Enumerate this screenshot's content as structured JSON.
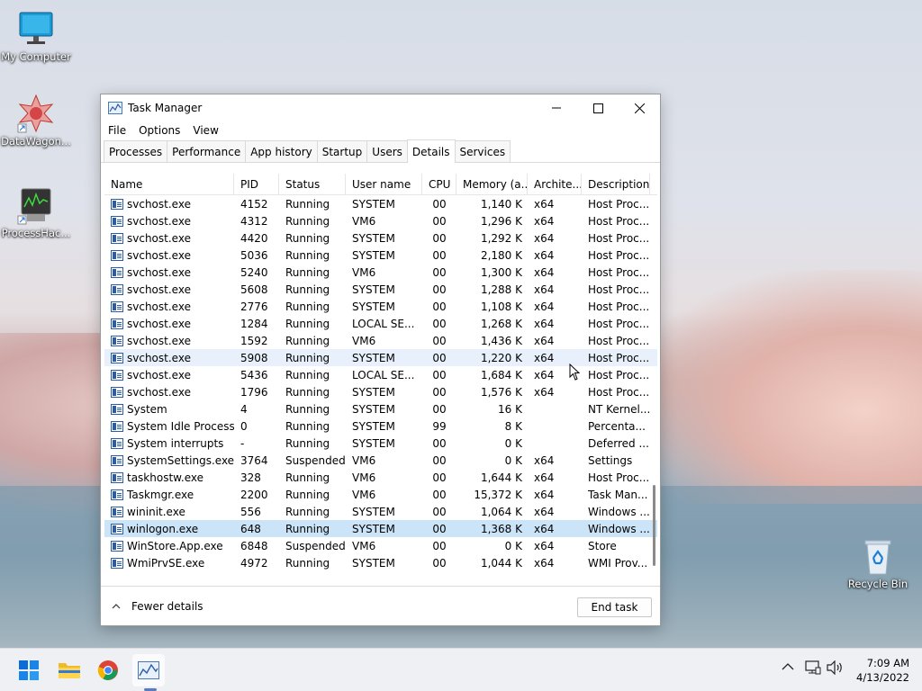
{
  "desktop": {
    "icons": [
      {
        "label": "My Computer"
      },
      {
        "label": "DataWagon..."
      },
      {
        "label": "ProcessHac..."
      },
      {
        "label": "Recycle Bin"
      }
    ]
  },
  "window": {
    "title": "Task Manager",
    "menu": [
      "File",
      "Options",
      "View"
    ],
    "tabs": [
      "Processes",
      "Performance",
      "App history",
      "Startup",
      "Users",
      "Details",
      "Services"
    ],
    "active_tab": "Details",
    "columns": [
      "Name",
      "PID",
      "Status",
      "User name",
      "CPU",
      "Memory (a...",
      "Archite...",
      "Description"
    ],
    "rows": [
      {
        "name": "svchost.exe",
        "pid": "4152",
        "status": "Running",
        "user": "SYSTEM",
        "cpu": "00",
        "mem": "1,140 K",
        "arch": "x64",
        "desc": "Host Proc..."
      },
      {
        "name": "svchost.exe",
        "pid": "4312",
        "status": "Running",
        "user": "VM6",
        "cpu": "00",
        "mem": "1,296 K",
        "arch": "x64",
        "desc": "Host Proc..."
      },
      {
        "name": "svchost.exe",
        "pid": "4420",
        "status": "Running",
        "user": "SYSTEM",
        "cpu": "00",
        "mem": "1,292 K",
        "arch": "x64",
        "desc": "Host Proc..."
      },
      {
        "name": "svchost.exe",
        "pid": "5036",
        "status": "Running",
        "user": "SYSTEM",
        "cpu": "00",
        "mem": "2,180 K",
        "arch": "x64",
        "desc": "Host Proc..."
      },
      {
        "name": "svchost.exe",
        "pid": "5240",
        "status": "Running",
        "user": "VM6",
        "cpu": "00",
        "mem": "1,300 K",
        "arch": "x64",
        "desc": "Host Proc..."
      },
      {
        "name": "svchost.exe",
        "pid": "5608",
        "status": "Running",
        "user": "SYSTEM",
        "cpu": "00",
        "mem": "1,288 K",
        "arch": "x64",
        "desc": "Host Proc..."
      },
      {
        "name": "svchost.exe",
        "pid": "2776",
        "status": "Running",
        "user": "SYSTEM",
        "cpu": "00",
        "mem": "1,108 K",
        "arch": "x64",
        "desc": "Host Proc..."
      },
      {
        "name": "svchost.exe",
        "pid": "1284",
        "status": "Running",
        "user": "LOCAL SE...",
        "cpu": "00",
        "mem": "1,268 K",
        "arch": "x64",
        "desc": "Host Proc..."
      },
      {
        "name": "svchost.exe",
        "pid": "1592",
        "status": "Running",
        "user": "VM6",
        "cpu": "00",
        "mem": "1,436 K",
        "arch": "x64",
        "desc": "Host Proc..."
      },
      {
        "name": "svchost.exe",
        "pid": "5908",
        "status": "Running",
        "user": "SYSTEM",
        "cpu": "00",
        "mem": "1,220 K",
        "arch": "x64",
        "desc": "Host Proc..."
      },
      {
        "name": "svchost.exe",
        "pid": "5436",
        "status": "Running",
        "user": "LOCAL SE...",
        "cpu": "00",
        "mem": "1,684 K",
        "arch": "x64",
        "desc": "Host Proc..."
      },
      {
        "name": "svchost.exe",
        "pid": "1796",
        "status": "Running",
        "user": "SYSTEM",
        "cpu": "00",
        "mem": "1,576 K",
        "arch": "x64",
        "desc": "Host Proc..."
      },
      {
        "name": "System",
        "pid": "4",
        "status": "Running",
        "user": "SYSTEM",
        "cpu": "00",
        "mem": "16 K",
        "arch": "",
        "desc": "NT Kernel..."
      },
      {
        "name": "System Idle Process",
        "pid": "0",
        "status": "Running",
        "user": "SYSTEM",
        "cpu": "99",
        "mem": "8 K",
        "arch": "",
        "desc": "Percenta..."
      },
      {
        "name": "System interrupts",
        "pid": "-",
        "status": "Running",
        "user": "SYSTEM",
        "cpu": "00",
        "mem": "0 K",
        "arch": "",
        "desc": "Deferred ..."
      },
      {
        "name": "SystemSettings.exe",
        "pid": "3764",
        "status": "Suspended",
        "user": "VM6",
        "cpu": "00",
        "mem": "0 K",
        "arch": "x64",
        "desc": "Settings"
      },
      {
        "name": "taskhostw.exe",
        "pid": "328",
        "status": "Running",
        "user": "VM6",
        "cpu": "00",
        "mem": "1,644 K",
        "arch": "x64",
        "desc": "Host Proc..."
      },
      {
        "name": "Taskmgr.exe",
        "pid": "2200",
        "status": "Running",
        "user": "VM6",
        "cpu": "00",
        "mem": "15,372 K",
        "arch": "x64",
        "desc": "Task Man..."
      },
      {
        "name": "wininit.exe",
        "pid": "556",
        "status": "Running",
        "user": "SYSTEM",
        "cpu": "00",
        "mem": "1,064 K",
        "arch": "x64",
        "desc": "Windows ..."
      },
      {
        "name": "winlogon.exe",
        "pid": "648",
        "status": "Running",
        "user": "SYSTEM",
        "cpu": "00",
        "mem": "1,368 K",
        "arch": "x64",
        "desc": "Windows ..."
      },
      {
        "name": "WinStore.App.exe",
        "pid": "6848",
        "status": "Suspended",
        "user": "VM6",
        "cpu": "00",
        "mem": "0 K",
        "arch": "x64",
        "desc": "Store"
      },
      {
        "name": "WmiPrvSE.exe",
        "pid": "4972",
        "status": "Running",
        "user": "SYSTEM",
        "cpu": "00",
        "mem": "1,044 K",
        "arch": "x64",
        "desc": "WMI Prov..."
      }
    ],
    "fewer_details": "Fewer details",
    "end_task": "End task"
  },
  "taskbar": {
    "time": "7:09 AM",
    "date": "4/13/2022"
  },
  "colors": {
    "selection": "#cce4f7",
    "hover": "#e8f1fb",
    "accent": "#0067c0"
  }
}
